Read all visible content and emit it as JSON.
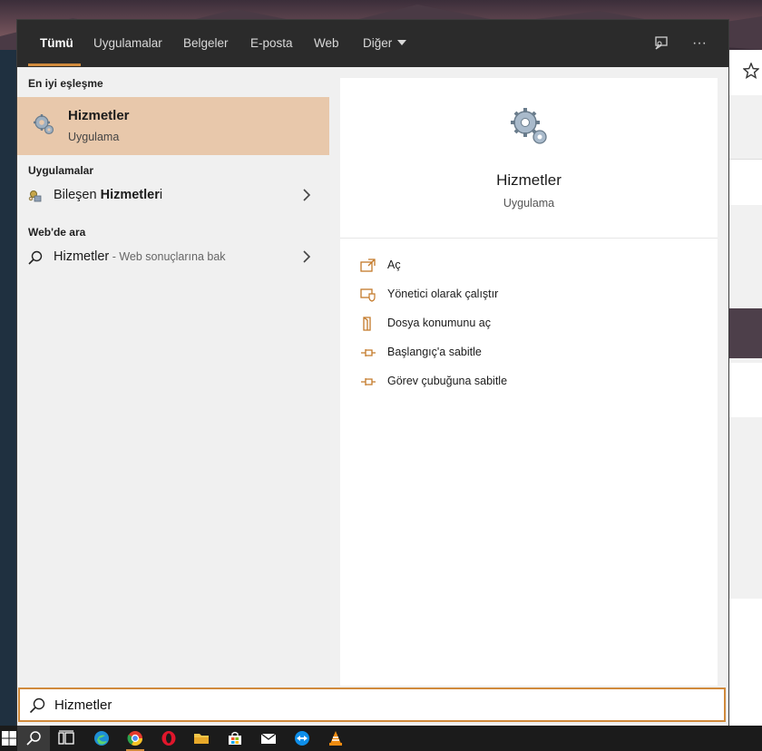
{
  "tabs": [
    {
      "label": "Tümü",
      "active": true
    },
    {
      "label": "Uygulamalar"
    },
    {
      "label": "Belgeler"
    },
    {
      "label": "E-posta"
    },
    {
      "label": "Web"
    },
    {
      "label": "Diğer"
    }
  ],
  "toolbar": {
    "feedback_icon": "feedback-icon",
    "more_label": "···"
  },
  "best_match": {
    "header": "En iyi eşleşme",
    "title": "Hizmetler",
    "subtitle": "Uygulama",
    "icon": "services-gear-icon"
  },
  "apps": {
    "header": "Uygulamalar",
    "items": [
      {
        "prefix": "Bileşen ",
        "bold": "Hizmetler",
        "suffix": "i",
        "icon": "component-services-icon"
      }
    ]
  },
  "web": {
    "header": "Web'de ara",
    "items": [
      {
        "term": "Hizmetler",
        "hint": " - Web sonuçlarına bak",
        "icon": "search-icon"
      }
    ]
  },
  "detail": {
    "title": "Hizmetler",
    "subtitle": "Uygulama",
    "actions": [
      {
        "label": "Aç",
        "icon": "open-icon"
      },
      {
        "label": "Yönetici olarak çalıştır",
        "icon": "run-as-admin-icon"
      },
      {
        "label": "Dosya konumunu aç",
        "icon": "open-file-location-icon"
      },
      {
        "label": "Başlangıç'a sabitle",
        "icon": "pin-to-start-icon"
      },
      {
        "label": "Görev çubuğuna sabitle",
        "icon": "pin-to-taskbar-icon"
      }
    ]
  },
  "search": {
    "value": "Hizmetler",
    "icon": "search-icon"
  },
  "taskbar": {
    "items": [
      "start-icon",
      "search-icon",
      "task-view-icon",
      "edge-icon",
      "chrome-icon",
      "opera-icon",
      "file-explorer-icon",
      "store-icon",
      "mail-icon",
      "teamviewer-icon",
      "vlc-icon"
    ]
  },
  "colors": {
    "accent": "#d08a3c",
    "selection": "#e8c8ab",
    "tabbar": "#2b2b2b",
    "taskbar": "#1b1b1b"
  }
}
